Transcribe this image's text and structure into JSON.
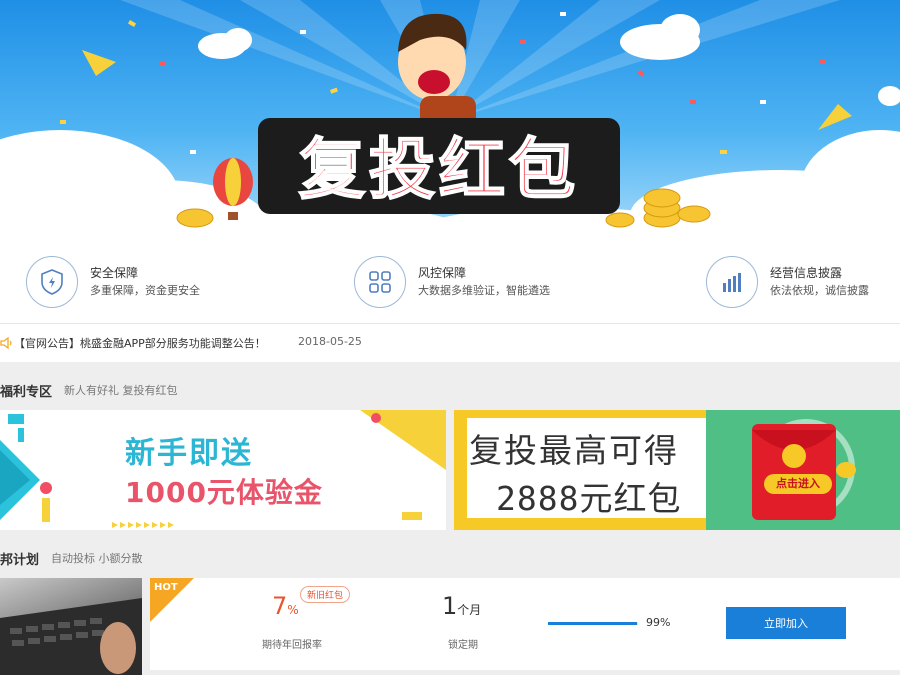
{
  "hero": {
    "title": "复投红包"
  },
  "features": [
    {
      "title": "安全保障",
      "desc": "多重保障，资金更安全",
      "icon": "shield-icon"
    },
    {
      "title": "风控保障",
      "desc": "大数据多维验证，智能遴选",
      "icon": "grid-icon"
    },
    {
      "title": "经营信息披露",
      "desc": "依法依规，诚信披露",
      "icon": "chart-bars-icon"
    }
  ],
  "notice": {
    "text": "【官网公告】桃盛金融APP部分服务功能调整公告！",
    "date": "2018-05-25",
    "icon": "speaker-icon"
  },
  "welfare": {
    "title": "福利专区",
    "subtitle": "新人有好礼 复投有红包"
  },
  "banner1": {
    "line1": "新手即送",
    "line2": "1000元体验金"
  },
  "banner2": {
    "line1": "复投最高可得",
    "line2": "2888元红包",
    "button": "点击进入"
  },
  "plan": {
    "title": "邦计划",
    "subtitle": "自动投标 小额分散"
  },
  "product": {
    "hot_label": "HOT",
    "rate_value": "7",
    "rate_unit": "%",
    "rate_tag": "新旧红包",
    "rate_label": "期待年回报率",
    "period_value": "1",
    "period_unit": "个月",
    "period_label": "锁定期",
    "progress": 0.99,
    "progress_text": "99%",
    "join_label": "立即加入"
  },
  "colors": {
    "accent": "#1a7fd9",
    "rate": "#e8542e",
    "hot": "#f5a623"
  }
}
